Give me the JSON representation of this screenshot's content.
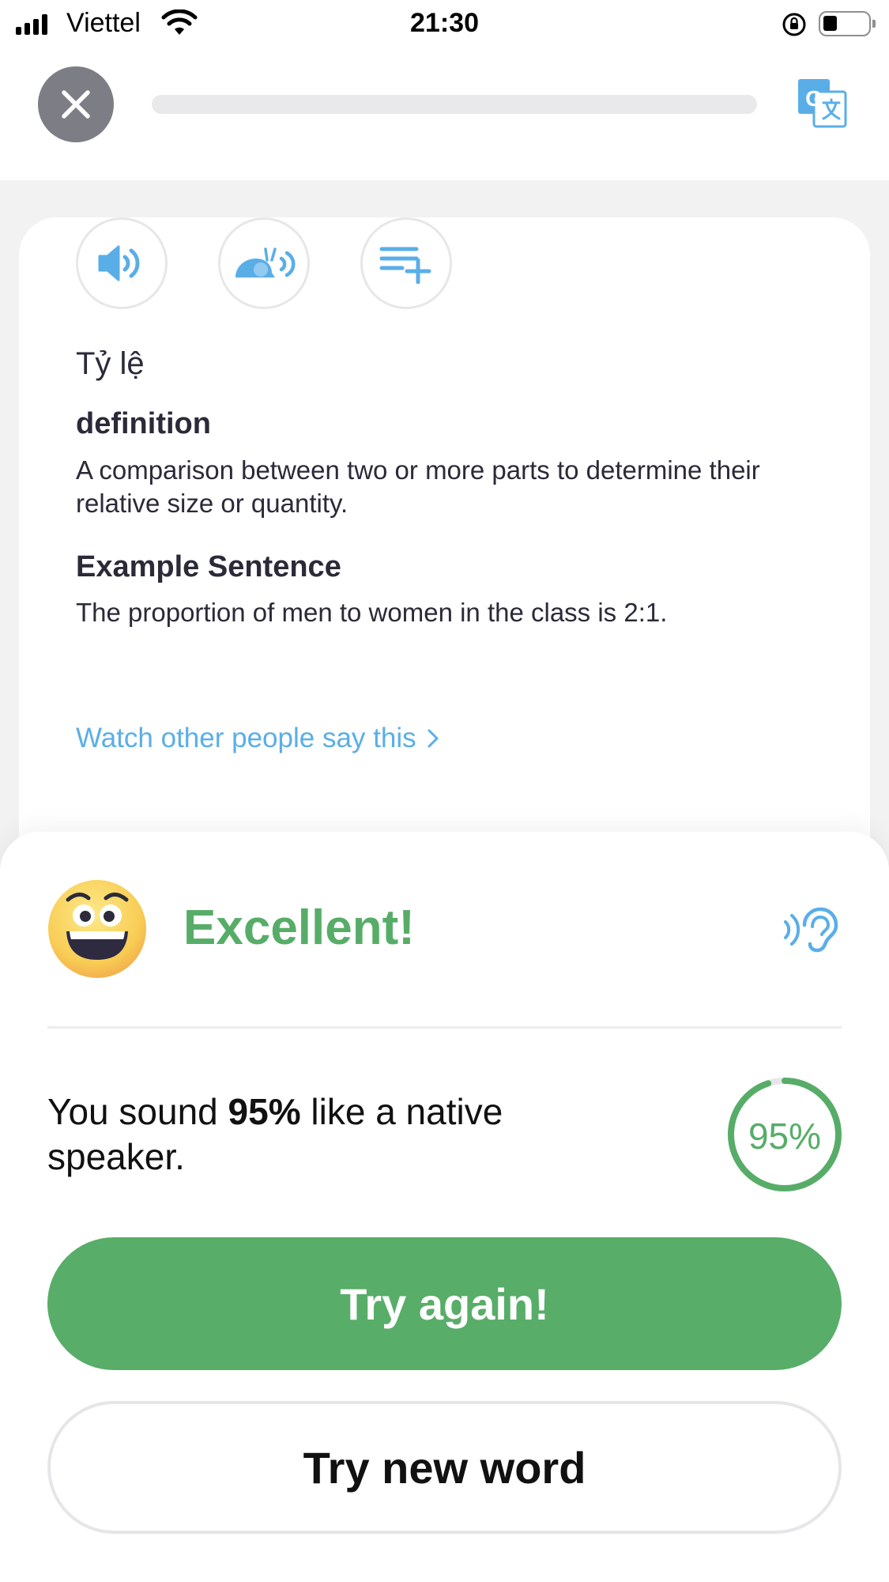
{
  "status_bar": {
    "carrier": "Viettel",
    "time": "21:30"
  },
  "top_nav": {
    "progress_fraction": 0.0
  },
  "word_card": {
    "word": "Tỷ lệ",
    "definition_title": "definition",
    "definition_text": "A comparison between two or more parts to determine their relative size or quantity.",
    "example_title": "Example Sentence",
    "example_text": "The proportion of men to women in the class is 2:1.",
    "watch_link": "Watch other people say this"
  },
  "result": {
    "title": "Excellent!",
    "score_prefix": "You sound ",
    "score_value": "95%",
    "score_suffix": " like a native speaker.",
    "ring_label": "95%",
    "ring_fraction": 0.95,
    "primary_button": "Try again!",
    "secondary_button": "Try new word"
  },
  "colors": {
    "accent_green": "#57ad68",
    "link_blue": "#5aaee8",
    "close_gray": "#7d7d85"
  },
  "icons": [
    "close-icon",
    "translate-icon",
    "speaker-icon",
    "slow-speaker-icon",
    "add-to-list-icon",
    "chevron-right-icon",
    "emoji-face-icon",
    "ear-listen-icon"
  ]
}
